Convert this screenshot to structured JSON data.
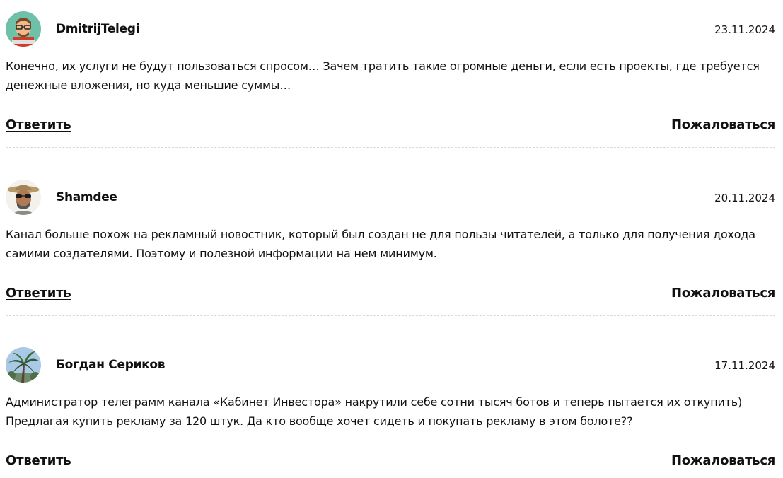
{
  "comments": [
    {
      "author": "DmitrijTelegi",
      "date": "23.11.2024",
      "text": "Конечно, их услуги не будут пользоваться спросом… Зачем тратить такие огромные деньги, если есть проекты, где требуется денежные вложения, но куда меньшие суммы…",
      "reply_label": "Ответить",
      "report_label": "Пожаловаться",
      "avatar_icon": "cartoon-avatar-icon"
    },
    {
      "author": "Shamdee",
      "date": "20.11.2024",
      "text": "Канал больше похож на рекламный новостник, который был создан не для пользы читателей, а только для получения дохода самими создателями. Поэтому и полезной информации на нем минимум.",
      "reply_label": "Ответить",
      "report_label": "Пожаловаться",
      "avatar_icon": "man-with-hat-avatar-icon"
    },
    {
      "author": "Богдан Сериков",
      "date": "17.11.2024",
      "text": "Администратор телеграмм канала «Кабинет Инвестора» накрутили себе сотни тысяч ботов и теперь пытается их откупить) Предлагая купить рекламу за 120 штук. Да кто вообще хочет сидеть и покупать рекламу в этом болоте??",
      "reply_label": "Ответить",
      "report_label": "Пожаловаться",
      "avatar_icon": "palm-tree-avatar-icon"
    }
  ]
}
